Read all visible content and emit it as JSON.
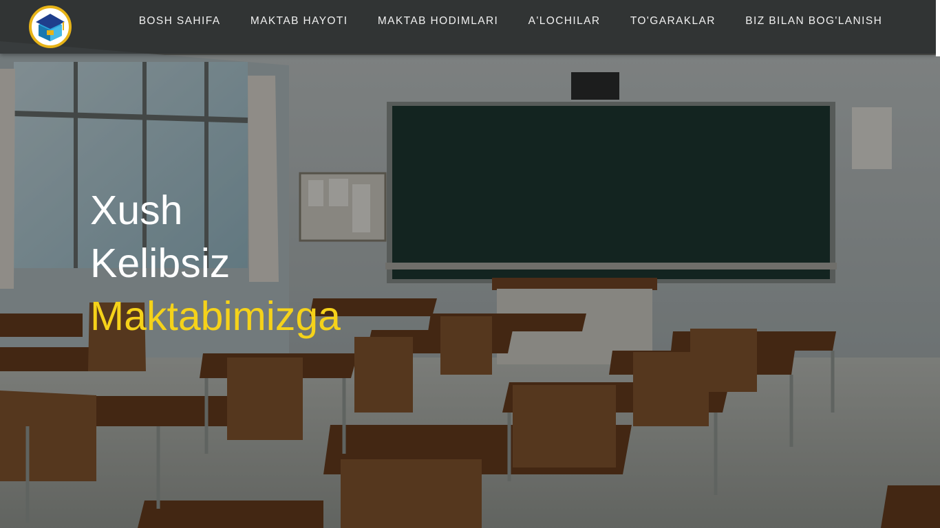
{
  "brand": {
    "logo_icon": "graduation-cap-box-icon",
    "ring_color": "#e7b317",
    "accent_color": "#f5d21a"
  },
  "nav": {
    "items": [
      {
        "label": "BOSH SAHIFA"
      },
      {
        "label": "MAKTAB HAYOTI"
      },
      {
        "label": "MAKTAB HODIMLARI"
      },
      {
        "label": "A'LOCHILAR"
      },
      {
        "label": "TO'GARAKLAR"
      },
      {
        "label": "BIZ BILAN BOG'LANISH"
      }
    ]
  },
  "hero": {
    "line1": "Xush",
    "line2": "Kelibsiz",
    "line3": "Maktabimizga",
    "background": "classroom-illustration"
  }
}
